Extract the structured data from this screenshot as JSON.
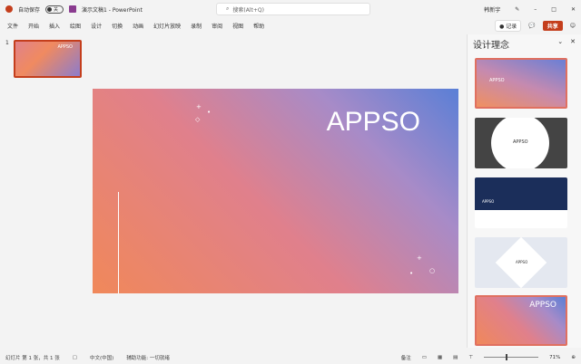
{
  "titlebar": {
    "autosave": "自动保存",
    "toggle": "关",
    "doc_title": "演示文稿1 - PowerPoint",
    "search_placeholder": "搜索(Alt+Q)",
    "user": "韩新宇",
    "min": "–",
    "max": "□",
    "close": "✕"
  },
  "menu": [
    "文件",
    "开始",
    "插入",
    "绘图",
    "设计",
    "切换",
    "动画",
    "幻灯片放映",
    "录制",
    "审阅",
    "视图",
    "帮助"
  ],
  "actions": {
    "record": "● 记录",
    "comment": "💬",
    "share": "共享",
    "smile": "☺"
  },
  "thumbnails": {
    "number": "1",
    "text": "APPSO"
  },
  "slide": {
    "title": "APPSO"
  },
  "designer": {
    "title": "设计理念",
    "collapse": "⌄",
    "close": "✕",
    "cards": [
      "APPSO",
      "APPSO",
      "APPSO",
      "APPSO",
      "APPSO"
    ]
  },
  "status": {
    "slide_info": "幻灯片 第 1 张，共 1 张",
    "language": "中文(中国)",
    "accessibility": "辅助功能: 一切就绪",
    "notes": "备注",
    "zoom": "71%"
  }
}
